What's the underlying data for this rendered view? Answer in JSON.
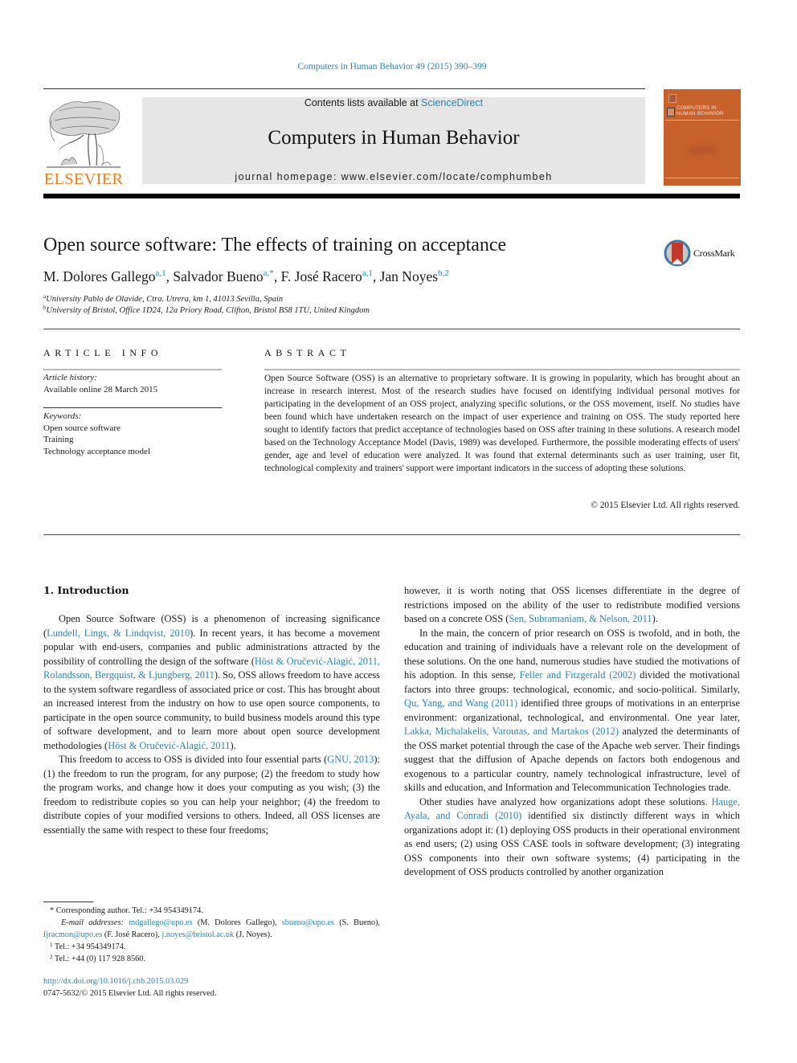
{
  "header": {
    "journal_citation": "Computers in Human Behavior 49 (2015) 390–399",
    "contents_prefix": "Contents lists available at ",
    "contents_link": "ScienceDirect",
    "journal_name": "Computers in Human Behavior",
    "homepage_prefix": "journal homepage: ",
    "homepage_url": "www.elsevier.com/locate/comphumbeh",
    "publisher_logo_text": "ELSEVIER",
    "cover_title_line1": "COMPUTERS IN",
    "cover_title_line2": "HUMAN BEHAVIOR",
    "crossmark_label": "CrossMark"
  },
  "colors": {
    "link": "#2a84b6",
    "elsevier_orange": "#ef7d22",
    "cover_orange": "#c8612b",
    "masthead_grey": "#e6e6e6"
  },
  "article": {
    "title": "Open source software: The effects of training on acceptance",
    "authors": [
      {
        "name": "M. Dolores Gallego",
        "sup": "a,1"
      },
      {
        "name": "Salvador Bueno",
        "sup": "a,*"
      },
      {
        "name": "F. José Racero",
        "sup": "a,1"
      },
      {
        "name": "Jan Noyes",
        "sup": "b,2"
      }
    ],
    "affiliations": [
      {
        "mark": "a",
        "text": "University Pablo de Olavide, Ctra. Utrera, km 1, 41013 Sevilla, Spain"
      },
      {
        "mark": "b",
        "text": "University of Bristol, Office 1D24, 12a Priory Road, Clifton, Bristol BS8 1TU, United Kingdom"
      }
    ]
  },
  "article_info": {
    "heading": "ARTICLE INFO",
    "history_label": "Article history:",
    "history_value": "Available online 28 March 2015",
    "keywords_label": "Keywords:",
    "keywords": [
      "Open source software",
      "Training",
      "Technology acceptance model"
    ]
  },
  "abstract": {
    "heading": "ABSTRACT",
    "text": "Open Source Software (OSS) is an alternative to proprietary software. It is growing in popularity, which has brought about an increase in research interest. Most of the research studies have focused on identifying individual personal motives for participating in the development of an OSS project, analyzing specific solutions, or the OSS movement, itself. No studies have been found which have undertaken research on the impact of user experience and training on OSS. The study reported here sought to identify factors that predict acceptance of technologies based on OSS after training in these solutions. A research model based on the Technology Acceptance Model (Davis, 1989) was developed. Furthermore, the possible moderating effects of users' gender, age and level of education were analyzed. It was found that external determinants such as user training, user fit, technological complexity and trainers' support were important indicators in the success of adopting these solutions.",
    "copyright": "© 2015 Elsevier Ltd. All rights reserved."
  },
  "body": {
    "intro_heading": "1. Introduction",
    "left_p1": [
      {
        "t": "Open Source Software (OSS) is a phenomenon of increasing significance ("
      },
      {
        "t": "Lundell, Lings, & Lindqvist, 2010",
        "link": true
      },
      {
        "t": "). In recent years, it has become a movement popular with end-users, companies and public administrations attracted by the possibility of controlling the design of the software ("
      },
      {
        "t": "Höst & Oručević-Alagić, 2011, Rolandsson, Bergquist, & Ljungberg, 2011",
        "link": true
      },
      {
        "t": "). So, OSS allows freedom to have access to the system software regardless of associated price or cost. This has brought about an increased interest from the industry on how to use open source components, to participate in the open source community, to build business models around this type of software development, and to learn more about open source development methodologies ("
      },
      {
        "t": "Höst & Oručević-Alagić, 2011",
        "link": true
      },
      {
        "t": ")."
      }
    ],
    "left_p2": [
      {
        "t": "This freedom to access to OSS is divided into four essential parts ("
      },
      {
        "t": "GNU, 2013",
        "link": true
      },
      {
        "t": "): (1) the freedom to run the program, for any purpose; (2) the freedom to study how the program works, and change how it does your computing as you wish; (3) the freedom to redistribute copies so you can help your neighbor; (4) the freedom to distribute copies of your modified versions to others. Indeed, all OSS licenses are essentially the same with respect to these four freedoms;"
      }
    ],
    "right_p1": [
      {
        "t": "however, it is worth noting that OSS licenses differentiate in the degree of restrictions imposed on the ability of the user to redistribute modified versions based on a concrete OSS ("
      },
      {
        "t": "Sen, Subramaniam, & Nelson, 2011",
        "link": true
      },
      {
        "t": ")."
      }
    ],
    "right_p2": [
      {
        "t": "In the main, the concern of prior research on OSS is twofold, and in both, the education and training of individuals have a relevant role on the development of these solutions. On the one hand, numerous studies have studied the motivations of his adoption. In this sense, "
      },
      {
        "t": "Feller and Fitzgerald (2002)",
        "link": true
      },
      {
        "t": " divided the motivational factors into three groups: technological, economic, and socio-political. Similarly, "
      },
      {
        "t": "Qu, Yang, and Wang (2011)",
        "link": true
      },
      {
        "t": " identified three groups of motivations in an enterprise environment: organizational, technological, and environmental. One year later, "
      },
      {
        "t": "Lakka, Michalakelis, Varoutas, and Martakos (2012)",
        "link": true
      },
      {
        "t": " analyzed the determinants of the OSS market potential through the case of the Apache web server. Their findings suggest that the diffusion of Apache depends on factors both endogenous and exogenous to a particular country, namely technological infrastructure, level of skills and education, and Information and Telecommunication Technologies trade."
      }
    ],
    "right_p3": [
      {
        "t": "Other studies have analyzed how organizations adopt these solutions. "
      },
      {
        "t": "Hauge, Ayala, and Conradi (2010)",
        "link": true
      },
      {
        "t": " identified six distinctly different ways in which organizations adopt it: (1) deploying OSS products in their operational environment as end users; (2) using OSS CASE tools in software development; (3) integrating OSS components into their own software systems; (4) participating in the development of OSS products controlled by another organization"
      }
    ]
  },
  "footnotes": {
    "corresponding": "Corresponding author. Tel.: +34 954349174.",
    "corresponding_mark": "*",
    "email_label": "E-mail addresses:",
    "emails": [
      {
        "address": "mdgallego@upo.es",
        "owner": " (M. Dolores Gallego), "
      },
      {
        "address": "sbueno@upo.es",
        "owner": " (S. Bueno), "
      },
      {
        "address": "fjracmon@upo.es",
        "owner": " (F. José Racero), "
      },
      {
        "address": "j.noyes@bristol.ac.uk",
        "owner": " (J. Noyes)."
      }
    ],
    "fn1_mark": "1",
    "fn1": "Tel.: +34 954349174.",
    "fn2_mark": "2",
    "fn2": "Tel.: +44 (0) 117 928 8560.",
    "doi": "http://dx.doi.org/10.1016/j.chb.2015.03.029",
    "issn_line": "0747-5632/© 2015 Elsevier Ltd. All rights reserved."
  }
}
